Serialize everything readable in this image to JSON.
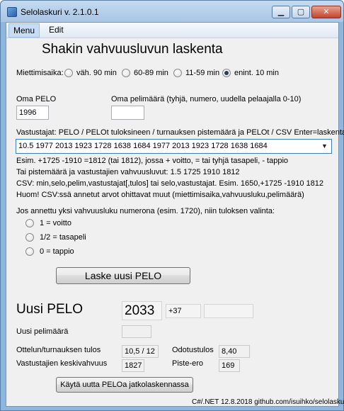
{
  "window": {
    "title": "Selolaskuri v. 2.1.0.1",
    "minimize_glyph": "▁",
    "maximize_glyph": "▢",
    "close_glyph": "✕"
  },
  "menu": [
    "Menu",
    "Edit"
  ],
  "heading": "Shakin vahvuusluvun laskenta",
  "time_control": {
    "label": "Miettimisaika:",
    "options": [
      "väh. 90 min",
      "60-89 min",
      "11-59 min",
      "enint. 10 min"
    ],
    "selected_index": 3
  },
  "own_pelo": {
    "label": "Oma PELO",
    "value": "1996"
  },
  "own_games": {
    "label": "Oma pelimäärä (tyhjä, numero, uudella pelaajalla 0-10)",
    "value": ""
  },
  "opponents": {
    "label": "Vastustajat: PELO / PELOt tuloksineen / turnauksen pistemäärä ja PELOt / CSV   Enter=laskenta",
    "value": "10.5 1977 2013 1923 1728 1638 1684 1977 2013 1923 1728 1638 1684",
    "arrow_glyph": "▼"
  },
  "help_lines": [
    "Esim. +1725 -1910 =1812 (tai 1812), jossa + voitto, = tai tyhjä tasapeli, - tappio",
    "Tai pistemäärä ja vastustajien vahvuusluvut: 1.5 1725 1910 1812",
    "CSV: min,selo,pelim,vastustajat[,tulos] tai selo,vastustajat. Esim. 1650,+1725 -1910 1812",
    "Huom! CSV:ssä annetut arvot ohittavat muut (miettimisaika,vahvuusluku,pelimäärä)"
  ],
  "single_result": {
    "label": "Jos annettu yksi vahvuusluku numerona (esim. 1720), niin tuloksen valinta:",
    "options": [
      "1 = voitto",
      "1/2 = tasapeli",
      "0 = tappio"
    ]
  },
  "calc_button": "Laske uusi PELO",
  "result": {
    "new_pelo_label": "Uusi PELO",
    "new_pelo_value": "2033",
    "change": "+37",
    "new_games_label": "Uusi pelimäärä",
    "new_games_value": "",
    "match_result_label": "Ottelun/turnauksen tulos",
    "match_result_value": "10,5 / 12",
    "expected_label": "Odotustulos",
    "expected_value": "8,40",
    "avg_label": "Vastustajien keskivahvuus",
    "avg_value": "1827",
    "points_diff_label": "Piste-ero",
    "points_diff_value": "169"
  },
  "continue_button": "Käytä uutta PELOa jatkolaskennassa",
  "footer": "C#/.NET 12.8.2018 github.com/isuihko/selolaskuri"
}
